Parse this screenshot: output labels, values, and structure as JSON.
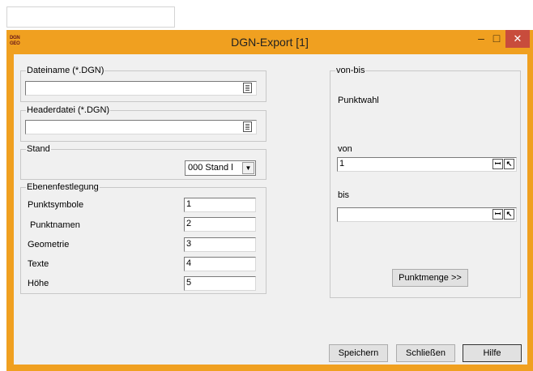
{
  "window": {
    "title": "DGN-Export [1]",
    "app_icon": "DGN GEO",
    "minimize": "–",
    "maximize": "□",
    "close": "✕"
  },
  "dateiname": {
    "legend": "Dateiname (*.DGN)",
    "value": ""
  },
  "headerdatei": {
    "legend": "Headerdatei (*.DGN)",
    "value": ""
  },
  "stand": {
    "legend": "Stand",
    "selected": "000    Stand l"
  },
  "ebenen": {
    "legend": "Ebenenfestlegung",
    "rows": [
      {
        "label": "Punktsymbole",
        "value": "1"
      },
      {
        "label": " Punktnamen",
        "value": "2"
      },
      {
        "label": "Geometrie",
        "value": "3"
      },
      {
        "label": "Texte",
        "value": "4"
      },
      {
        "label": "Höhe",
        "value": "5"
      }
    ]
  },
  "vonbis": {
    "legend": "von-bis",
    "punktwahl": "Punktwahl",
    "von_label": "von",
    "von_value": "1",
    "bis_label": "bis",
    "bis_value": "",
    "punktmenge": "Punktmenge >>"
  },
  "buttons": {
    "speichern": "Speichern",
    "schliessen": "Schließen",
    "hilfe": "Hilfe"
  }
}
